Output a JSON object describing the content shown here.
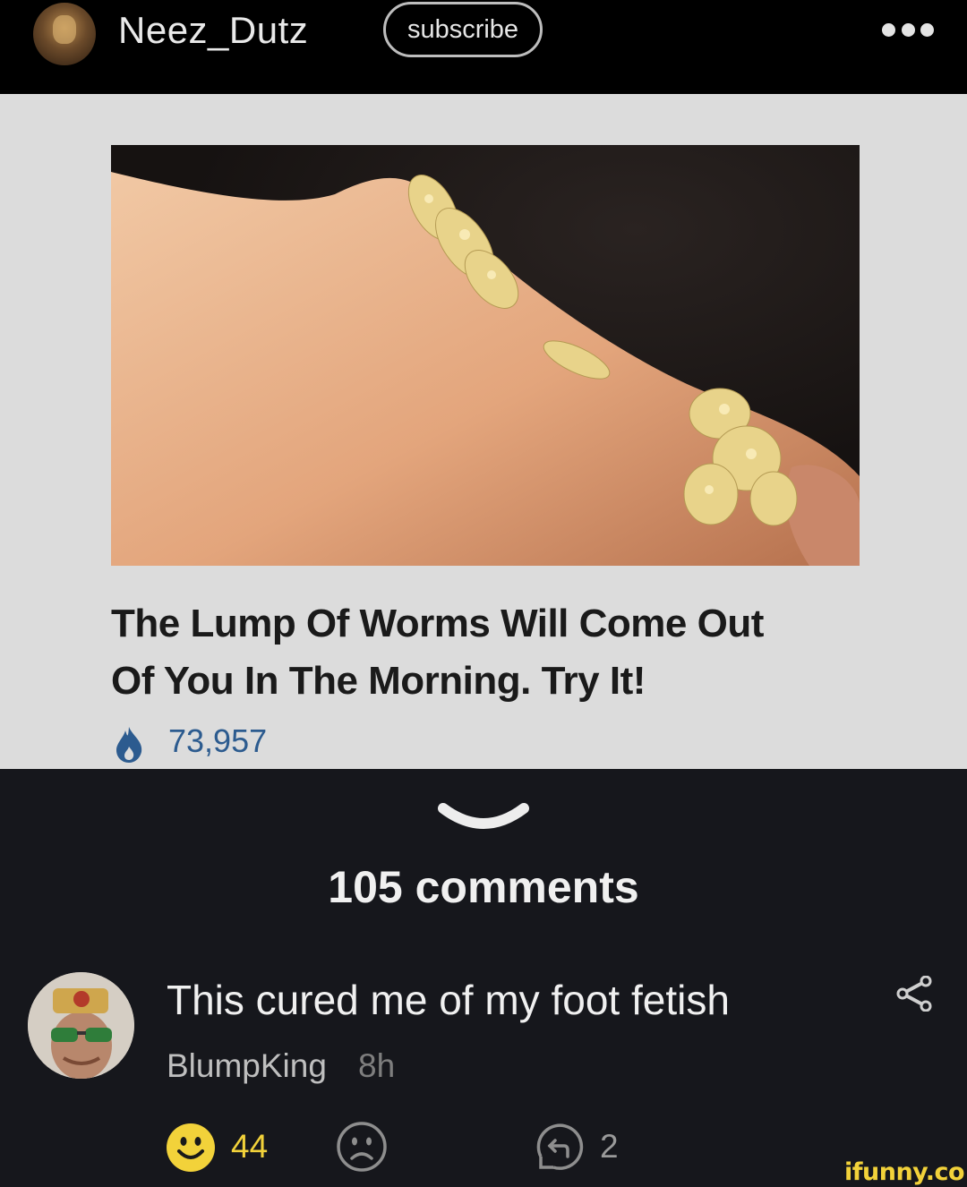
{
  "header": {
    "username": "Neez_Dutz",
    "subscribe_label": "subscribe",
    "more_icon": "more-dots-icon"
  },
  "post": {
    "headline_line1": "The Lump Of Worms Will Come Out",
    "headline_line2": "Of You In The Morning. Try It!",
    "views": "73,957",
    "views_icon": "fire-icon",
    "views_color": "#2c5b8f"
  },
  "comments": {
    "count_label": "105 comments",
    "items": [
      {
        "text": "This cured me of my foot fetish",
        "author": "BlumpKing",
        "time": "8h",
        "smiles": "44",
        "replies": "2"
      }
    ]
  },
  "watermark": "ifunny.co",
  "colors": {
    "accent_yellow": "#f2d23a",
    "background": "#16171c",
    "header": "#000000",
    "post_background": "#dcdcdc"
  }
}
